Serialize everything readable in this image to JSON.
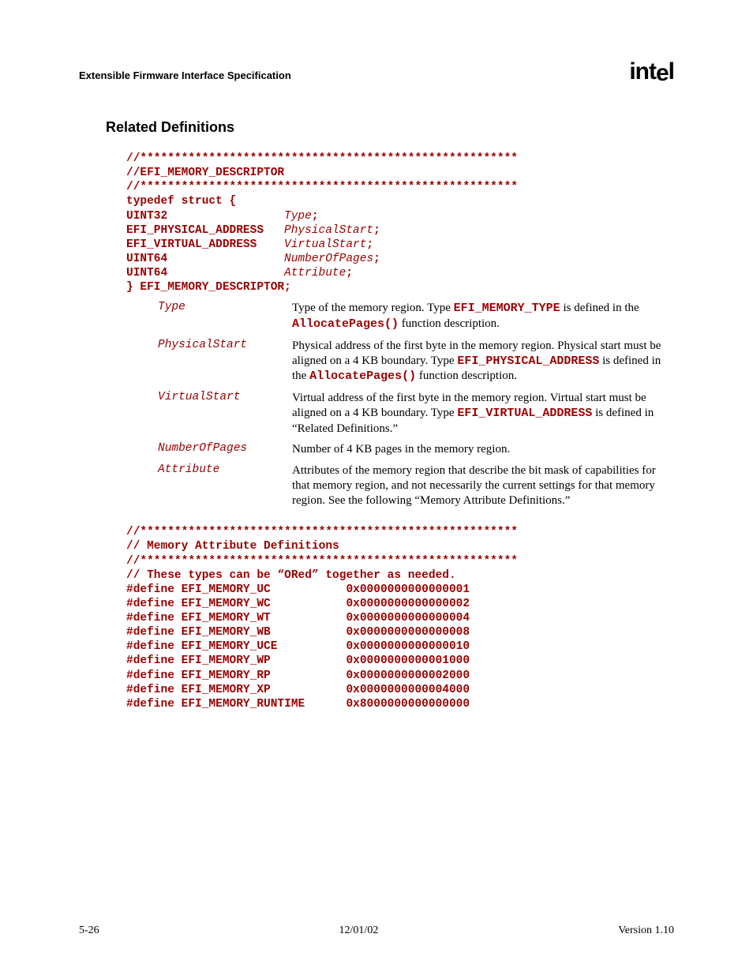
{
  "header": {
    "title": "Extensible Firmware Interface Specification",
    "logo": "intel"
  },
  "section": {
    "title": "Related Definitions"
  },
  "code1": {
    "divider": "//*******************************************************",
    "comment": "//EFI_MEMORY_DESCRIPTOR",
    "typedef": "typedef struct {",
    "row1a": "UINT32",
    "row1b": "Type",
    "row1c": ";",
    "row2a": "EFI_PHYSICAL_ADDRESS",
    "row2b": "PhysicalStart",
    "row2c": ";",
    "row3a": "EFI_VIRTUAL_ADDRESS",
    "row3b": "VirtualStart",
    "row3c": ";",
    "row4a": "UINT64",
    "row4b": "NumberOfPages",
    "row4c": ";",
    "row5a": "UINT64",
    "row5b": "Attribute",
    "row5c": ";",
    "close": "} EFI_MEMORY_DESCRIPTOR;"
  },
  "defs": {
    "r1": {
      "term": "Type",
      "t1": "Type of the memory region.  Type ",
      "m1": "EFI_MEMORY_TYPE",
      "t2": " is defined in the ",
      "m2": "AllocatePages()",
      "t3": " function description."
    },
    "r2": {
      "term": "PhysicalStart",
      "t1": "Physical address of the first byte in the memory region.  Physical start must be aligned on a 4 KB boundary.  Type ",
      "m1": "EFI_PHYSICAL_ADDRESS",
      "t2": " is defined in the ",
      "m2": "AllocatePages()",
      "t3": " function description."
    },
    "r3": {
      "term": "VirtualStart",
      "t1": "Virtual address of the first byte in the memory region.  Virtual start must be aligned on a 4 KB boundary.  Type ",
      "m1": "EFI_VIRTUAL_ADDRESS",
      "t2": " is defined in “Related Definitions.”"
    },
    "r4": {
      "term": "NumberOfPages",
      "t1": "Number of 4 KB pages in the memory region."
    },
    "r5": {
      "term": "Attribute",
      "t1": "Attributes of the memory region that describe the bit mask of capabilities for that memory region, and not necessarily the current settings for that memory region.  See the following “Memory Attribute Definitions.”"
    }
  },
  "code2": {
    "divider": "//*******************************************************",
    "title": "// Memory Attribute Definitions",
    "comment": "// These types can be “ORed” together as needed.",
    "l1": "#define EFI_MEMORY_UC           0x0000000000000001",
    "l2": "#define EFI_MEMORY_WC           0x0000000000000002",
    "l3": "#define EFI_MEMORY_WT           0x0000000000000004",
    "l4": "#define EFI_MEMORY_WB           0x0000000000000008",
    "l5": "#define EFI_MEMORY_UCE          0x0000000000000010",
    "l6": "#define EFI_MEMORY_WP           0x0000000000001000",
    "l7": "#define EFI_MEMORY_RP           0x0000000000002000",
    "l8": "#define EFI_MEMORY_XP           0x0000000000004000",
    "l9": "#define EFI_MEMORY_RUNTIME      0x8000000000000000"
  },
  "footer": {
    "left": "5-26",
    "center": "12/01/02",
    "right": "Version 1.10"
  }
}
